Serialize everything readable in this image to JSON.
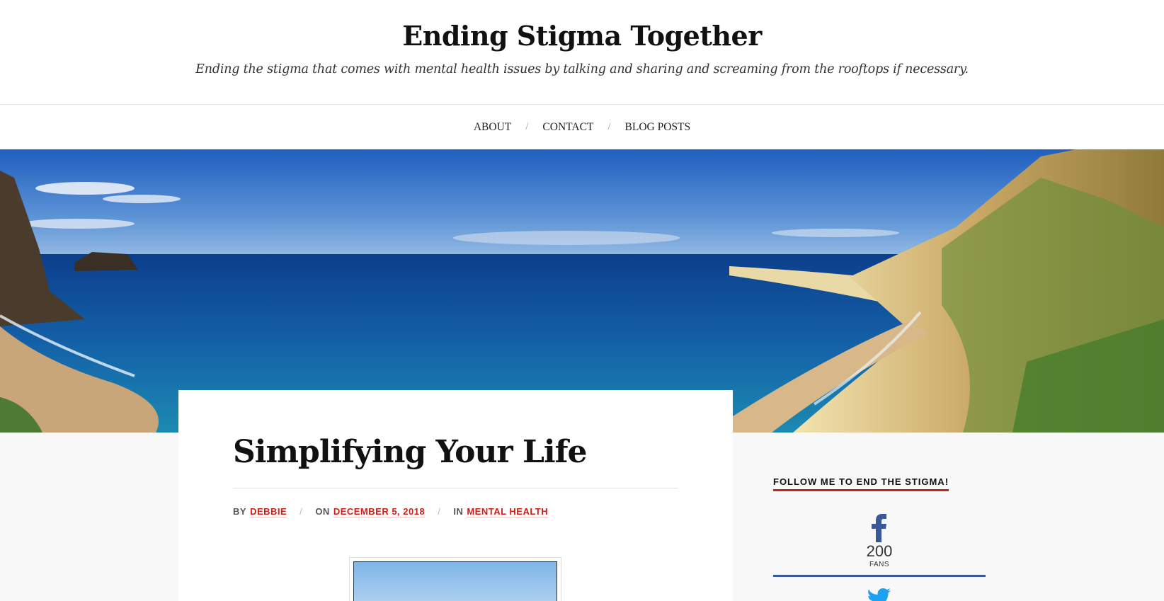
{
  "site": {
    "title": "Ending Stigma Together",
    "description": "Ending the stigma that comes with mental health issues by talking and sharing and screaming from the rooftops if necessary."
  },
  "nav": {
    "items": [
      {
        "label": "About"
      },
      {
        "label": "Contact"
      },
      {
        "label": "Blog Posts"
      }
    ],
    "separator": "/"
  },
  "post": {
    "title": "Simplifying Your Life",
    "meta": {
      "by_prefix": "By",
      "author": "Debbie",
      "on_prefix": "On",
      "date": "December 5, 2018",
      "in_prefix": "In",
      "category": "Mental Health",
      "separator": "/"
    }
  },
  "sidebar": {
    "widget_title": "Follow me to end the stigma!",
    "facebook": {
      "icon": "facebook-icon",
      "count": "200",
      "label": "Fans",
      "color": "#3b5998"
    },
    "twitter": {
      "icon": "twitter-icon",
      "color": "#1da1f2"
    }
  },
  "colors": {
    "accent": "#ca2017",
    "background": "#f8f8f8"
  }
}
